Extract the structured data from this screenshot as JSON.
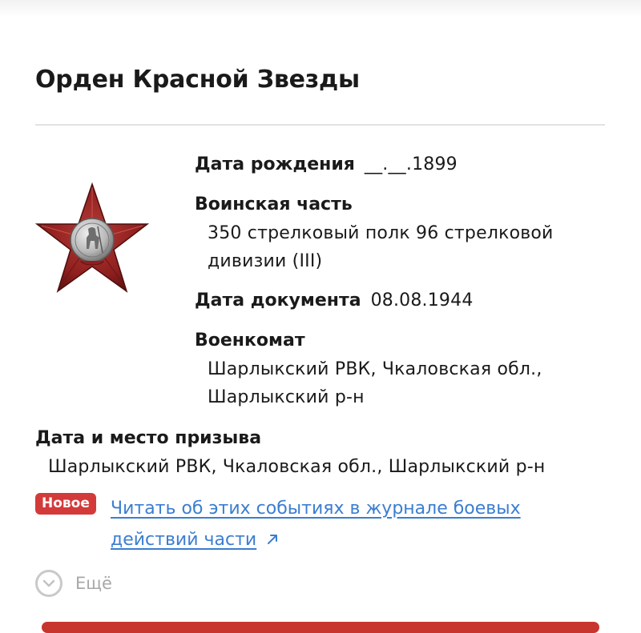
{
  "page": {
    "title": "Орден Красной Звезды"
  },
  "award": {
    "icon": "red-star-order-icon",
    "colors": {
      "star": "#8e1f1e",
      "star_highlight": "#b53a35",
      "silver": "#b9b9b9"
    }
  },
  "info": {
    "birth": {
      "label": "Дата рождения",
      "value": "__.__.1899"
    },
    "unit": {
      "label": "Воинская часть",
      "value_line1": "350 стрелковый полк 96 стрелковой",
      "value_line2": "дивизии (III)"
    },
    "document_date": {
      "label": "Дата документа",
      "value": "08.08.1944"
    },
    "military_office": {
      "label": "Военкомат",
      "value_line1": "Шарлыкский РВК, Чкаловская обл.,",
      "value_line2": "Шарлыкский р-н"
    }
  },
  "draft": {
    "label": "Дата и место призыва",
    "value": "Шарлыкский РВК, Чкаловская обл., Шарлыкский р-н"
  },
  "journal": {
    "badge": "Новое",
    "link_line1": "Читать об этих событиях в журнале боевых",
    "link_line2": "действий части",
    "link_icon": "external-link-arrow-icon"
  },
  "more": {
    "label": "Ещё",
    "icon": "chevron-down-circle-icon"
  },
  "colors": {
    "accent_link": "#3b7ed0",
    "badge_red": "#d33a3a",
    "muted": "#a8a8a8"
  }
}
